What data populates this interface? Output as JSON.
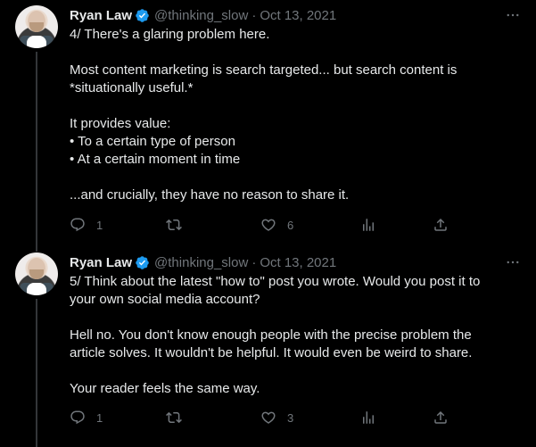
{
  "tweets": [
    {
      "author": {
        "name": "Ryan Law",
        "handle": "@thinking_slow"
      },
      "date": "Oct 13, 2021",
      "lines": [
        "4/ There's a glaring problem here.",
        "",
        "Most content marketing is search targeted... but search content is",
        "*situationally useful.*",
        "",
        "It provides value:",
        "• To a certain type of person",
        "• At a certain moment in time",
        "",
        "...and crucially, they have no reason to share it."
      ],
      "replies": "1",
      "retweets": "",
      "likes": "6"
    },
    {
      "author": {
        "name": "Ryan Law",
        "handle": "@thinking_slow"
      },
      "date": "Oct 13, 2021",
      "lines": [
        "5/ Think about the latest \"how to\" post you wrote. Would you post it to",
        "your own social media account?",
        "",
        "Hell no. You don't know enough people with the precise problem the",
        "article solves. It wouldn't be helpful. It would even be weird to share.",
        "",
        "Your reader feels the same way."
      ],
      "replies": "1",
      "retweets": "",
      "likes": "3"
    }
  ],
  "icons": {
    "verified": "verified-badge-icon",
    "more": "more-options-icon",
    "reply": "reply-icon",
    "retweet": "retweet-icon",
    "like": "heart-icon",
    "views": "analytics-icon",
    "share": "share-icon"
  },
  "colors": {
    "background": "#000000",
    "text": "#e7e9ea",
    "muted": "#71767b",
    "verified": "#1d9bf0",
    "thread_line": "#333639"
  }
}
